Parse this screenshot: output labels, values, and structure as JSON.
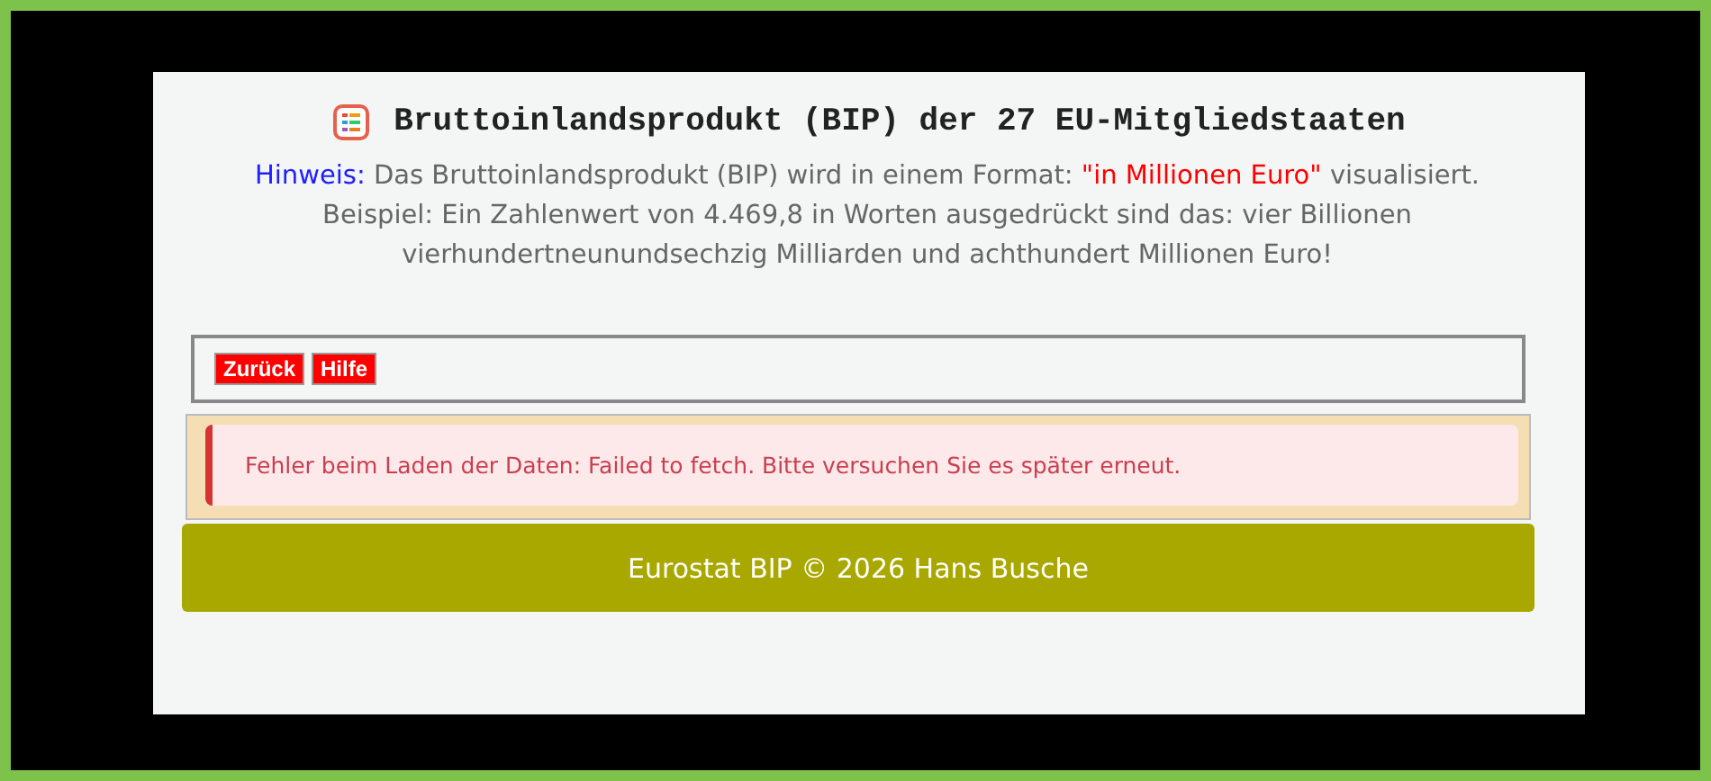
{
  "title": "Bruttoinlandsprodukt (BIP) der 27 EU-Mitgliedstaaten",
  "notice": {
    "label": "Hinweis:",
    "text_before": " Das Bruttoinlandsprodukt (BIP) wird in einem Format: ",
    "highlight": "\"in Millionen Euro\"",
    "text_after": " visualisiert. Beispiel: Ein Zahlenwert von 4.469,8 in Worten ausgedrückt sind das: vier Billionen vierhundertneunundsechzig Milliarden und achthundert Millionen Euro!"
  },
  "buttons": [
    {
      "label": "Zurück"
    },
    {
      "label": "Hilfe"
    }
  ],
  "error": "Fehler beim Laden der Daten: Failed to fetch. Bitte versuchen Sie es später erneut.",
  "footer": "Eurostat BIP © 2026 Hans Busche"
}
